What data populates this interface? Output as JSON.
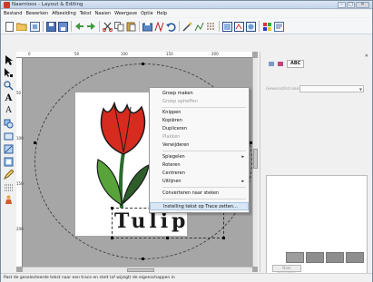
{
  "window": {
    "title": "Naamloos - Layout & Editing"
  },
  "menubar": {
    "items": [
      "Bestand",
      "Bewerken",
      "Afbeelding",
      "Tekst",
      "Naaien",
      "Weergave",
      "Optie",
      "Help"
    ]
  },
  "canvas": {
    "ruler_h_labels": [
      "0",
      "50",
      "100",
      "150",
      "200"
    ],
    "ruler_v_labels": [
      "50",
      "100",
      "150",
      "200"
    ],
    "text": "Tulip",
    "colors": {
      "petal": "#d62b1e",
      "leaf": "#58a43a",
      "stem": "#2c6b2f"
    }
  },
  "context_menu": {
    "items": [
      {
        "label": "Groep maken",
        "enabled": true,
        "submenu": false
      },
      {
        "label": "Groep opheffen",
        "enabled": false,
        "submenu": false
      },
      {
        "label": "Knippen",
        "enabled": true,
        "submenu": false
      },
      {
        "label": "Kopiëren",
        "enabled": true,
        "submenu": false
      },
      {
        "label": "Dupliceren",
        "enabled": true,
        "submenu": false
      },
      {
        "label": "Plakken",
        "enabled": false,
        "submenu": false
      },
      {
        "label": "Verwijderen",
        "enabled": true,
        "submenu": false
      },
      {
        "label": "Spiegelen",
        "enabled": true,
        "submenu": true
      },
      {
        "label": "Roteren",
        "enabled": true,
        "submenu": false
      },
      {
        "label": "Centreren",
        "enabled": true,
        "submenu": false
      },
      {
        "label": "Uitlijnen",
        "enabled": true,
        "submenu": true
      },
      {
        "label": "Converteren naar steken",
        "enabled": true,
        "submenu": false
      },
      {
        "label": "Instelling tekst op Trace zetten...",
        "enabled": true,
        "submenu": false,
        "highlighted": true
      }
    ]
  },
  "right_panel": {
    "tab_label": "ABC",
    "field_label": "Gewenst/ist-aanl",
    "button_label": "Naar bewerken"
  },
  "statusbar": {
    "text": "Past de geselecteerde tekst naar een trace en stelt (of wijzigt) de eigenschappen in"
  }
}
